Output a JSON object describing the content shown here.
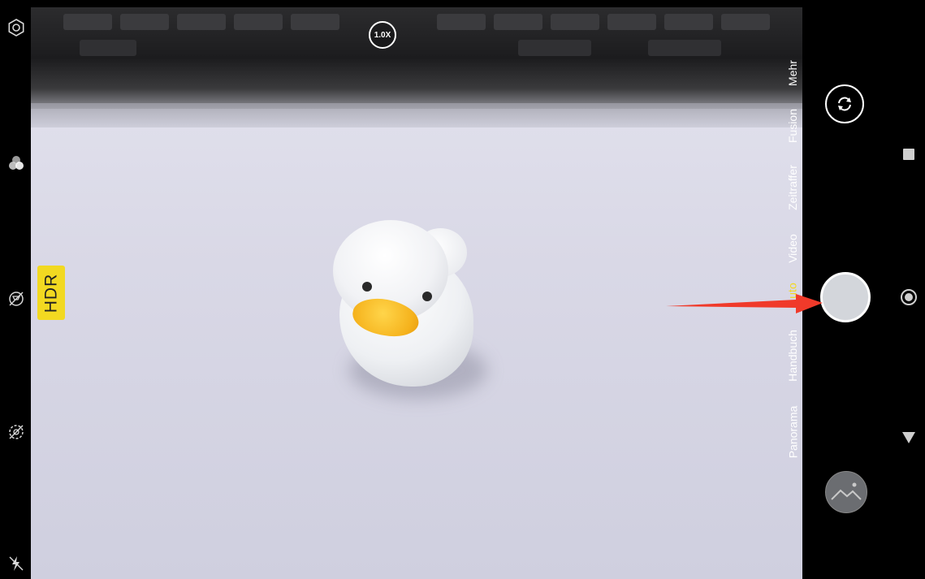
{
  "viewfinder": {
    "zoom_label": "1.0X"
  },
  "left_toolbar": {
    "items": [
      {
        "icon": "settings-icon"
      },
      {
        "icon": "filters-icon"
      },
      {
        "icon": "hdr-off-icon"
      },
      {
        "icon": "live-photo-off-icon"
      },
      {
        "icon": "flash-off-icon"
      }
    ],
    "hdr_badge": "HDR"
  },
  "mode_selector": {
    "modes": [
      {
        "label": "Mehr",
        "active": false
      },
      {
        "label": "Fusion",
        "active": false
      },
      {
        "label": "Zeitraffer",
        "active": false
      },
      {
        "label": "Video",
        "active": false
      },
      {
        "label": "uto",
        "active": true
      },
      {
        "label": "Handbuch",
        "active": false
      },
      {
        "label": "Panorama",
        "active": false
      }
    ]
  },
  "controls": {
    "switch_camera_icon": "switch-camera-icon",
    "gallery_icon": "gallery-icon"
  },
  "colors": {
    "accent": "#f2d921",
    "annotation_arrow": "#f03a2a"
  }
}
